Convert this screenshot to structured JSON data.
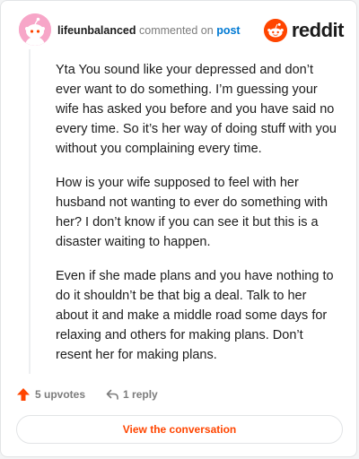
{
  "header": {
    "username": "lifeunbalanced",
    "action_text": "commented on",
    "post_link": "post"
  },
  "brand": {
    "name": "reddit",
    "icon": "reddit-logo-icon",
    "color": "#ff4500"
  },
  "comment": {
    "paragraphs": [
      "Yta You sound like your depressed and don’t ever want to do something. I’m guessing your wife has asked you before and you have said no every time. So it’s her way of doing stuff with you without you complaining every time.",
      "How is your wife supposed to feel with her husband not wanting to ever do something with her? I don’t know if you can see it but this is a disaster waiting to happen.",
      "Even if she made plans and you have nothing to do it shouldn’t be that big a deal. Talk to her about it and make a middle road some days for relaxing and others for making plans. Don’t resent her for making plans."
    ]
  },
  "footer": {
    "upvotes_label": "5 upvotes",
    "reply_label": "1 reply",
    "upvote_icon": "upvote-arrow-icon",
    "reply_icon": "reply-arrow-icon"
  },
  "cta": {
    "label": "View the conversation"
  },
  "colors": {
    "accent": "#ff4500",
    "link": "#0079d3",
    "avatar_bg": "#f7a6c8"
  }
}
